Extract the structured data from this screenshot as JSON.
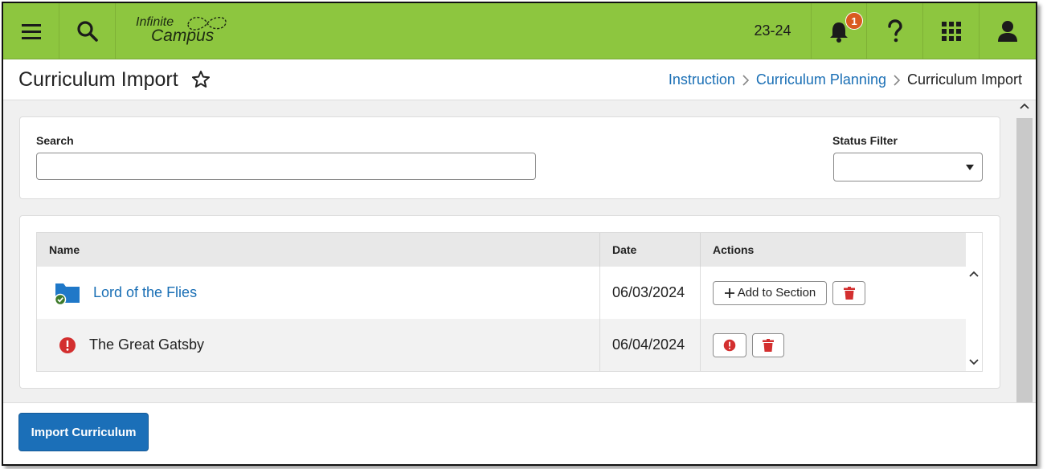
{
  "topbar": {
    "logo_line1": "Infinite",
    "logo_line2": "Campus",
    "year": "23-24",
    "notification_count": "1",
    "bar_color": "#8dc63f"
  },
  "header": {
    "title": "Curriculum Import",
    "breadcrumbs": [
      "Instruction",
      "Curriculum Planning",
      "Curriculum Import"
    ]
  },
  "filters": {
    "search_label": "Search",
    "search_value": "",
    "status_label": "Status Filter",
    "status_value": ""
  },
  "table": {
    "columns": [
      "Name",
      "Date",
      "Actions"
    ],
    "rows": [
      {
        "name": "Lord of the Flies",
        "date": "06/03/2024",
        "status": "success",
        "action_label": "Add to Section"
      },
      {
        "name": "The Great Gatsby",
        "date": "06/04/2024",
        "status": "error"
      }
    ]
  },
  "footer": {
    "import_label": "Import Curriculum"
  },
  "colors": {
    "accent": "#1a6fb5",
    "primary_button": "#1b6fb8",
    "danger": "#d32f2f",
    "success": "#3d7a2a"
  }
}
